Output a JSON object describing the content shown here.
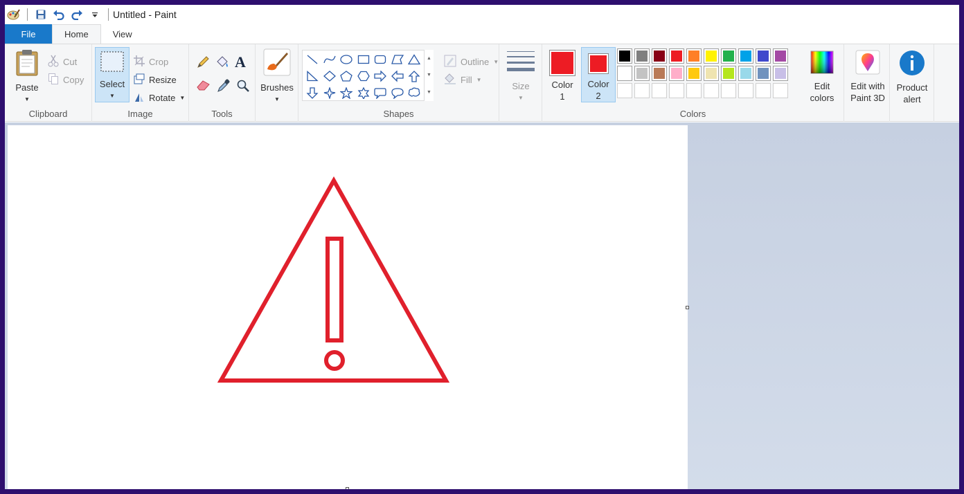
{
  "window": {
    "title": "Untitled - Paint"
  },
  "quick_access": {
    "icons": [
      "paint-app-icon",
      "save-icon",
      "undo-icon",
      "redo-icon",
      "customize-qat-icon"
    ]
  },
  "tabs": [
    {
      "label": "File"
    },
    {
      "label": "Home"
    },
    {
      "label": "View"
    }
  ],
  "ribbon": {
    "clipboard": {
      "group_label": "Clipboard",
      "paste_label": "Paste",
      "cut_label": "Cut",
      "copy_label": "Copy"
    },
    "image": {
      "group_label": "Image",
      "select_label": "Select",
      "crop_label": "Crop",
      "resize_label": "Resize",
      "rotate_label": "Rotate"
    },
    "tools": {
      "group_label": "Tools",
      "icons": [
        "pencil-icon",
        "fill-bucket-icon",
        "text-icon",
        "eraser-icon",
        "color-picker-icon",
        "magnifier-icon"
      ]
    },
    "brushes": {
      "label": "Brushes"
    },
    "shapes": {
      "group_label": "Shapes",
      "outline_label": "Outline",
      "fill_label": "Fill",
      "items": [
        "line",
        "curve",
        "oval",
        "rectangle",
        "rounded-rectangle",
        "polygon",
        "triangle",
        "right-triangle",
        "diamond",
        "pentagon",
        "hexagon",
        "right-arrow",
        "left-arrow",
        "up-arrow",
        "down-arrow",
        "four-point-star",
        "five-point-star",
        "six-point-star",
        "rounded-callout",
        "oval-callout",
        "cloud-callout"
      ]
    },
    "size": {
      "label": "Size"
    },
    "colors": {
      "group_label": "Colors",
      "color1_label": "Color",
      "color1_num": "1",
      "color2_label": "Color",
      "color2_num": "2",
      "color1_value": "#ed1c24",
      "color2_value": "#ed1c24",
      "palette": [
        "#000000",
        "#7f7f7f",
        "#880015",
        "#ed1c24",
        "#ff7f27",
        "#fff200",
        "#22b14c",
        "#00a2e8",
        "#3f48cc",
        "#a349a4",
        "#ffffff",
        "#c3c3c3",
        "#b97a57",
        "#ffaec9",
        "#ffc90e",
        "#efe4b0",
        "#b5e61d",
        "#99d9ea",
        "#7092be",
        "#c8bfe7",
        "",
        "",
        "",
        "",
        "",
        "",
        "",
        "",
        "",
        ""
      ],
      "edit_colors_label_1": "Edit",
      "edit_colors_label_2": "colors"
    },
    "paint3d": {
      "label_1": "Edit with",
      "label_2": "Paint 3D"
    },
    "product_alert": {
      "label_1": "Product",
      "label_2": "alert"
    }
  },
  "drawing": {
    "stroke_color": "#e0202c",
    "subject": "warning-triangle-with-exclamation"
  }
}
